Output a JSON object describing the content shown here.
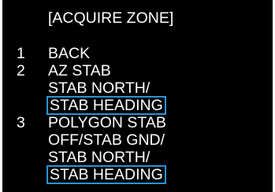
{
  "menu": {
    "title": "[ACQUIRE ZONE]",
    "items": [
      {
        "number": "1",
        "label": "BACK"
      },
      {
        "number": "2",
        "label": "AZ STAB",
        "options": [
          "STAB NORTH/",
          "STAB HEADING"
        ],
        "selected_option": "STAB HEADING"
      },
      {
        "number": "3",
        "label": "POLYGON STAB",
        "options": [
          "OFF/STAB GND/",
          "STAB NORTH/",
          "STAB HEADING"
        ],
        "selected_option": "STAB HEADING"
      }
    ]
  },
  "colors": {
    "background": "#000000",
    "text": "#ffffff",
    "selection_border": "#2a93d5"
  }
}
